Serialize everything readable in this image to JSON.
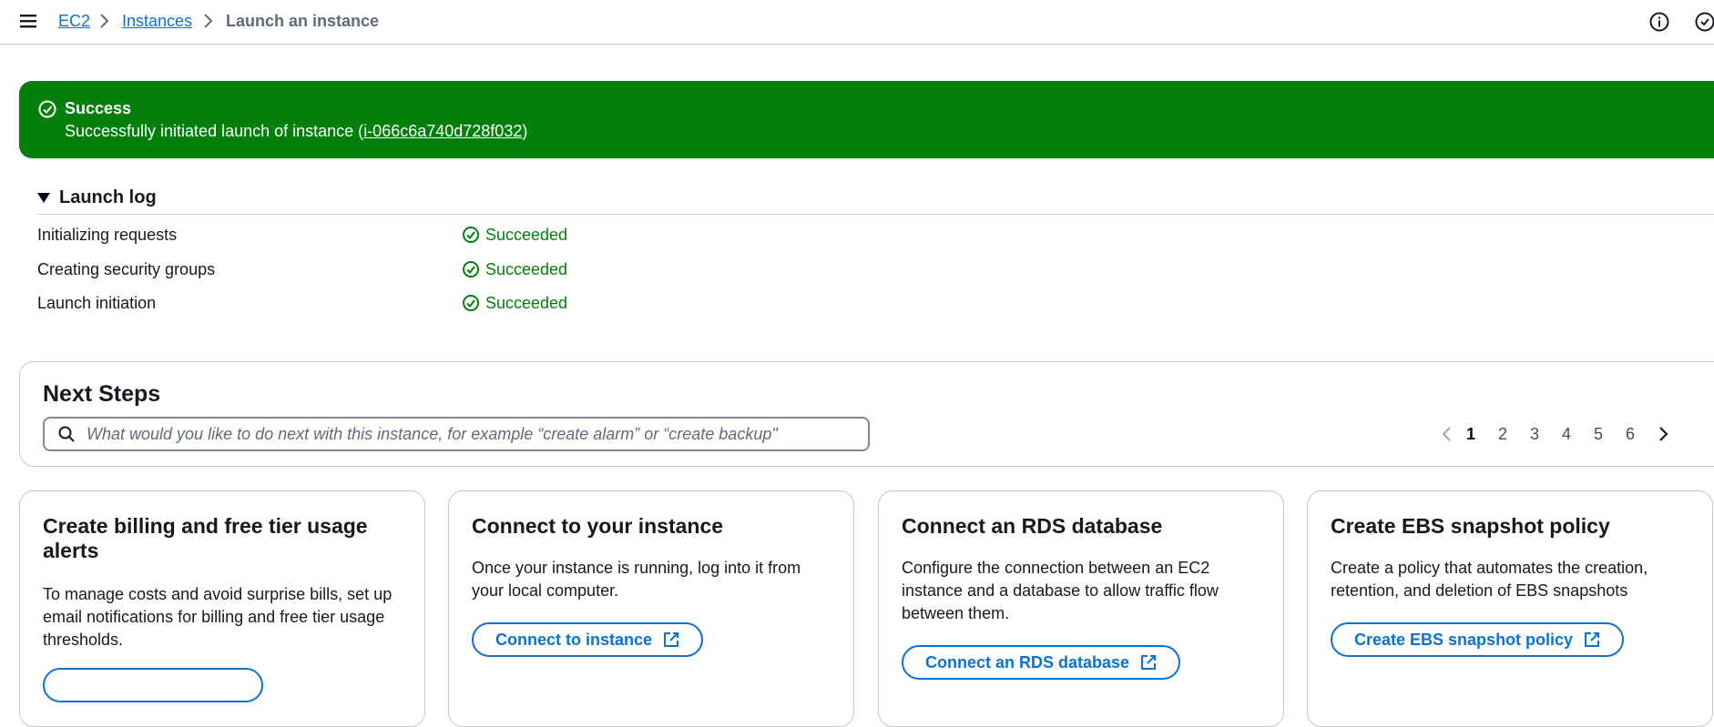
{
  "breadcrumb": {
    "items": [
      "EC2",
      "Instances",
      "Launch an instance"
    ]
  },
  "flash": {
    "type": "success",
    "title": "Success",
    "message_prefix": "Successfully initiated launch of instance (",
    "instance_id": "i-066c6a740d728f032",
    "message_suffix": ")"
  },
  "launch_log": {
    "title": "Launch log",
    "rows": [
      {
        "label": "Initializing requests",
        "status": "Succeeded"
      },
      {
        "label": "Creating security groups",
        "status": "Succeeded"
      },
      {
        "label": "Launch initiation",
        "status": "Succeeded"
      }
    ]
  },
  "next_steps": {
    "title": "Next Steps",
    "search_placeholder": "What would you like to do next with this instance, for example “create alarm” or “create backup\"",
    "pages": [
      "1",
      "2",
      "3",
      "4",
      "5",
      "6"
    ],
    "current_page": "1"
  },
  "cards": [
    {
      "title": "Create billing and free tier usage alerts",
      "description": "To manage costs and avoid surprise bills, set up email notifications for billing and free tier usage thresholds.",
      "button": ""
    },
    {
      "title": "Connect to your instance",
      "description": "Once your instance is running, log into it from your local computer.",
      "button": "Connect to instance"
    },
    {
      "title": "Connect an RDS database",
      "description": "Configure the connection between an EC2 instance and a database to allow traffic flow between them.",
      "button": "Connect an RDS database"
    },
    {
      "title": "Create EBS snapshot policy",
      "description": "Create a policy that automates the creation, retention, and deletion of EBS snapshots",
      "button": "Create EBS snapshot policy"
    }
  ],
  "colors": {
    "success_green": "#037f0c",
    "link_blue": "#0972d3",
    "border_gray": "#c6c6cd"
  }
}
